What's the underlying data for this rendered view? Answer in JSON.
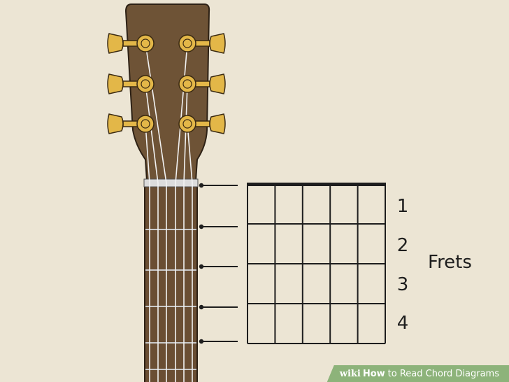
{
  "diagram": {
    "fret_labels": [
      "1",
      "2",
      "3",
      "4"
    ],
    "frets_caption": "Frets",
    "string_count": 6,
    "fret_count": 4
  },
  "watermark": {
    "brand": "wiki",
    "how": "How",
    "title": "to Read Chord Diagrams"
  },
  "colors": {
    "background": "#ece5d4",
    "headstock": "#6e5336",
    "fretboard": "#6a4e33",
    "tuner": "#e3b748",
    "nut": "#dcdcdc",
    "strings": "#f2f2f2",
    "grid_lines": "#1e1e1e",
    "watermark_bg": "#8db37a"
  },
  "icons": {
    "tuner": "tuning-peg-icon",
    "pointer": "leader-line-dot-icon"
  }
}
